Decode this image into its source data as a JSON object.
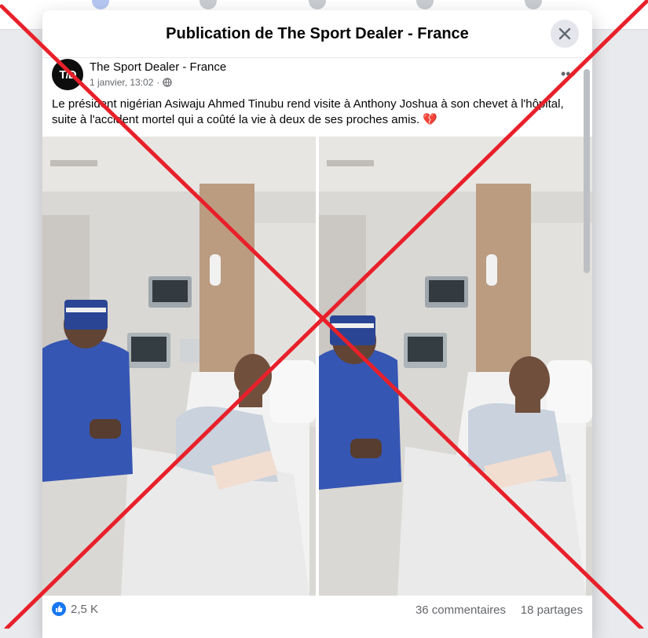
{
  "dialog": {
    "title": "Publication de The Sport Dealer - France"
  },
  "post": {
    "author": "The Sport Dealer - France",
    "avatar_text": "T/D",
    "timestamp": "1 janvier, 13:02",
    "visibility_icon": "globe-icon",
    "text": "Le président nigérian Asiwaju Ahmed Tinubu rend visite à Anthony Joshua à son chevet à l'hôpital, suite à l'accident mortel qui a coûté la vie à deux de ses proches amis. 💔",
    "photos": [
      {
        "name": "hospital-visit-photo-1"
      },
      {
        "name": "hospital-visit-photo-2"
      }
    ],
    "reactions_count": "2,5 K",
    "comments_count": "36 commentaires",
    "shares_count": "18 partages"
  },
  "colors": {
    "overlay_red": "#e8202a",
    "like_blue": "#1877f2",
    "robe_blue": "#2c4db0"
  }
}
